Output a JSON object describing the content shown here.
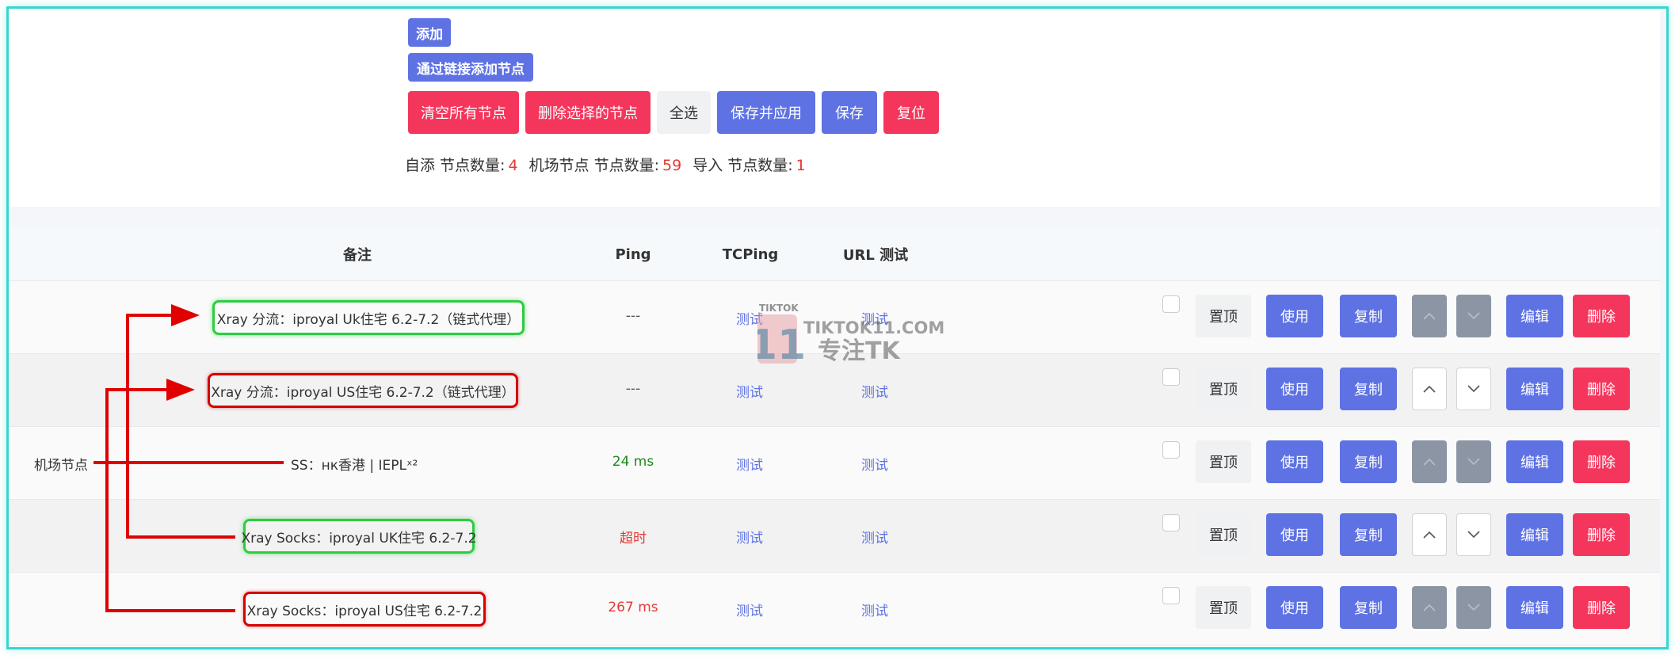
{
  "toolbar": {
    "add_label": "添加",
    "add_by_link_label": "通过链接添加节点",
    "clear_all_label": "清空所有节点",
    "delete_selected_label": "删除选择的节点",
    "select_all_label": "全选",
    "save_apply_label": "保存并应用",
    "save_label": "保存",
    "reset_label": "复位"
  },
  "counts": {
    "custom_label": "自添 节点数量:",
    "custom_value": "4",
    "airport_label": "机场节点 节点数量:",
    "airport_value": "59",
    "import_label": "导入 节点数量:",
    "import_value": "1"
  },
  "table": {
    "headers": {
      "remark": "备注",
      "ping": "Ping",
      "tcping": "TCPing",
      "url_test": "URL 测试"
    },
    "rows": [
      {
        "group": "",
        "remark": "Xray 分流：iproyal Uk住宅 6.2-7.2（链式代理）",
        "ping": "---",
        "ping_color": "#555555",
        "tcping": "测试",
        "url_test": "测试",
        "top": "置顶",
        "use": "使用",
        "copy": "复制",
        "edit": "编辑",
        "delete": "删除",
        "outline": "green",
        "arrows_enabled": false
      },
      {
        "group": "",
        "remark": "Xray 分流：iproyal US住宅 6.2-7.2（链式代理）",
        "ping": "---",
        "ping_color": "#555555",
        "tcping": "测试",
        "url_test": "测试",
        "top": "置顶",
        "use": "使用",
        "copy": "复制",
        "edit": "编辑",
        "delete": "删除",
        "outline": "red",
        "arrows_enabled": true
      },
      {
        "group": "机场节点",
        "remark": "SS：нк香港 | IEPLˣ²",
        "ping": "24 ms",
        "ping_color": "#1a8a1a",
        "tcping": "测试",
        "url_test": "测试",
        "top": "置顶",
        "use": "使用",
        "copy": "复制",
        "edit": "编辑",
        "delete": "删除",
        "outline": "none",
        "arrows_enabled": false
      },
      {
        "group": "",
        "remark": "Xray Socks：iproyal UK住宅 6.2-7.2",
        "ping": "超时",
        "ping_color": "#e53935",
        "tcping": "测试",
        "url_test": "测试",
        "top": "置顶",
        "use": "使用",
        "copy": "复制",
        "edit": "编辑",
        "delete": "删除",
        "outline": "green",
        "arrows_enabled": true
      },
      {
        "group": "",
        "remark": "Xray Socks：iproyal US住宅 6.2-7.2",
        "ping": "267 ms",
        "ping_color": "#e53935",
        "tcping": "测试",
        "url_test": "测试",
        "top": "置顶",
        "use": "使用",
        "copy": "复制",
        "edit": "编辑",
        "delete": "删除",
        "outline": "red",
        "arrows_enabled": false
      }
    ]
  },
  "watermark": {
    "small_text": "TIKTOK",
    "domain_text": "TIKTOK11.COM",
    "slogan_text": "专注TK",
    "logo_number": "11"
  },
  "colors": {
    "primary": "#5e72e4",
    "danger": "#f5365c",
    "annotation_red": "#e00000",
    "annotation_green": "#2ecc40",
    "frame": "#35d7d0"
  },
  "icons": {
    "move_up": "chevron-up-icon",
    "move_down": "chevron-down-icon",
    "annotation_arrow": "arrow-right-icon"
  }
}
